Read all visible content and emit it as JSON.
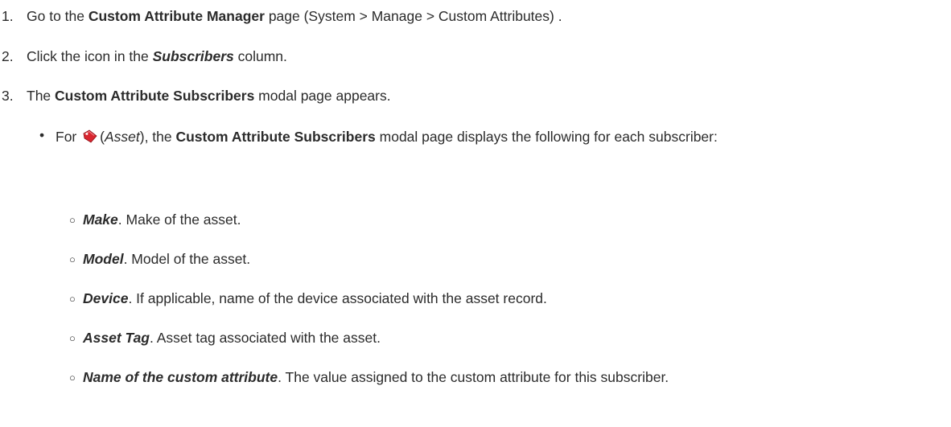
{
  "steps": [
    {
      "number": "1.",
      "pre": "Go to the ",
      "bold": "Custom Attribute Manager",
      "post": " page (System > Manage > Custom Attributes) ."
    },
    {
      "number": "2.",
      "pre": "Click the icon in the ",
      "bold_italic": "Subscribers",
      "post": " column."
    },
    {
      "number": "3.",
      "pre": "The ",
      "bold": "Custom Attribute Subscribers",
      "post": " modal page appears."
    }
  ],
  "bullet": {
    "marker": "•",
    "pre": "For ",
    "icon": "asset-tag-icon",
    "paren_italic": "Asset",
    "mid": ", the ",
    "bold": "Custom Attribute Subscribers",
    "post": " modal page displays the following for each subscriber:"
  },
  "sub_items": [
    {
      "marker": "○",
      "term": "Make",
      "desc": ". Make of the asset."
    },
    {
      "marker": "○",
      "term": "Model",
      "desc": ". Model of the asset."
    },
    {
      "marker": "○",
      "term": "Device",
      "desc": ". If applicable, name of the device associated with the asset record."
    },
    {
      "marker": "○",
      "term": "Asset Tag",
      "desc": ". Asset tag associated with the asset."
    },
    {
      "marker": "○",
      "term": "Name of the custom attribute",
      "desc": ". The value assigned to the custom attribute for this subscriber."
    }
  ],
  "colors": {
    "text": "#2b2b2b",
    "icon_red": "#d8262f"
  }
}
